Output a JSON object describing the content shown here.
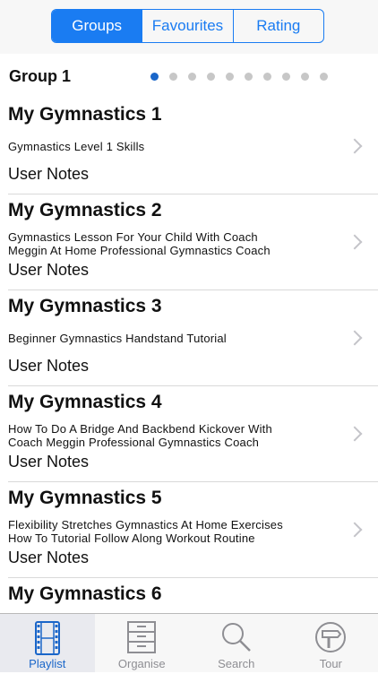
{
  "segments": [
    {
      "label": "Groups",
      "active": true
    },
    {
      "label": "Favourites",
      "active": false
    },
    {
      "label": "Rating",
      "active": false
    }
  ],
  "group": {
    "title": "Group 1",
    "page_count": 10,
    "current_page": 1
  },
  "items": [
    {
      "title": "My Gymnastics 1",
      "desc_lines": [
        "Gymnastics Level 1 Skills"
      ],
      "notes": "User Notes"
    },
    {
      "title": "My Gymnastics 2",
      "desc_lines": [
        "Gymnastics Lesson For Your Child With Coach",
        "Meggin At Home Professional Gymnastics Coach"
      ],
      "notes": "User Notes"
    },
    {
      "title": "My Gymnastics 3",
      "desc_lines": [
        "Beginner Gymnastics Handstand Tutorial"
      ],
      "notes": "User Notes"
    },
    {
      "title": "My Gymnastics 4",
      "desc_lines": [
        "How To Do A Bridge And Backbend Kickover With",
        "Coach Meggin Professional Gymnastics Coach"
      ],
      "notes": "User Notes"
    },
    {
      "title": "My Gymnastics 5",
      "desc_lines": [
        "Flexibility Stretches Gymnastics At Home Exercises",
        "How To Tutorial  Follow Along Workout Routine"
      ],
      "notes": "User Notes"
    },
    {
      "title": "My Gymnastics 6",
      "desc_lines": [],
      "notes": ""
    }
  ],
  "tabbar": [
    {
      "label": "Playlist",
      "icon": "film-strip-icon",
      "active": true
    },
    {
      "label": "Organise",
      "icon": "cabinet-icon",
      "active": false
    },
    {
      "label": "Search",
      "icon": "magnifier-icon",
      "active": false
    },
    {
      "label": "Tour",
      "icon": "signpost-icon",
      "active": false
    }
  ],
  "colors": {
    "accent": "#1a7cf2",
    "active_tab": "#1a66c9",
    "inactive": "#8e8e93"
  }
}
